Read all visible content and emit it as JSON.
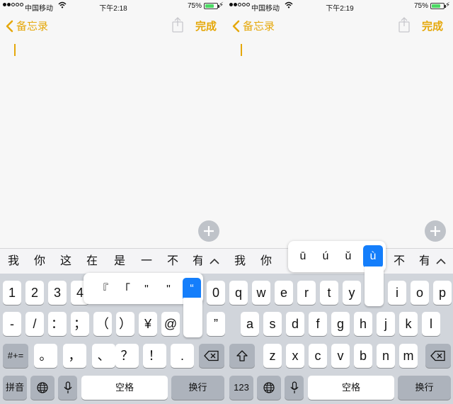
{
  "colors": {
    "accent": "#e5a80b",
    "selected": "#147efb",
    "keyboard_bg": "#d1d5db",
    "battery": "#4cd964"
  },
  "icons": {
    "wifi": "wifi-icon",
    "back": "chevron-left-icon",
    "share": "share-icon",
    "plus": "plus-icon",
    "globe": "globe-icon",
    "mic": "microphone-icon",
    "shift": "shift-icon",
    "delete": "delete-icon",
    "expand": "chevron-up-icon"
  },
  "left": {
    "status": {
      "carrier": "中国移动",
      "time": "下午2:18",
      "battery": "75%"
    },
    "nav": {
      "back": "备忘录",
      "done": "完成"
    },
    "candidates": [
      "我",
      "你",
      "这",
      "在",
      "是",
      "一",
      "不",
      "有"
    ],
    "popup": [
      "『",
      "「",
      "\"",
      "\"",
      "“"
    ],
    "rows": {
      "r1": [
        "1",
        "2",
        "3",
        "4",
        "",
        "",
        "",
        "",
        "",
        "0"
      ],
      "r2": [
        "-",
        "/",
        "：",
        "；",
        "（",
        "）",
        "¥",
        "@",
        "",
        "”"
      ],
      "r3": {
        "sym": "#+=",
        "keys": [
          "。",
          "，",
          "、",
          "？",
          "！",
          "."
        ]
      },
      "r4": {
        "lang": "拼音",
        "space": "空格",
        "ret": "换行"
      }
    }
  },
  "right": {
    "status": {
      "carrier": "中国移动",
      "time": "下午2:19",
      "battery": "75%"
    },
    "nav": {
      "back": "备忘录",
      "done": "完成"
    },
    "candidates": [
      "我",
      "你",
      "",
      "",
      "",
      "",
      "不",
      "有"
    ],
    "popup": [
      "ū",
      "ú",
      "ǔ",
      "ù"
    ],
    "rows": {
      "r1": [
        "q",
        "w",
        "e",
        "r",
        "t",
        "y",
        "",
        "i",
        "o",
        "p"
      ],
      "r2": [
        "a",
        "s",
        "d",
        "f",
        "g",
        "h",
        "j",
        "k",
        "l"
      ],
      "r3": [
        "z",
        "x",
        "c",
        "v",
        "b",
        "n",
        "m"
      ],
      "r4": {
        "num": "123",
        "space": "空格",
        "ret": "换行"
      }
    }
  }
}
